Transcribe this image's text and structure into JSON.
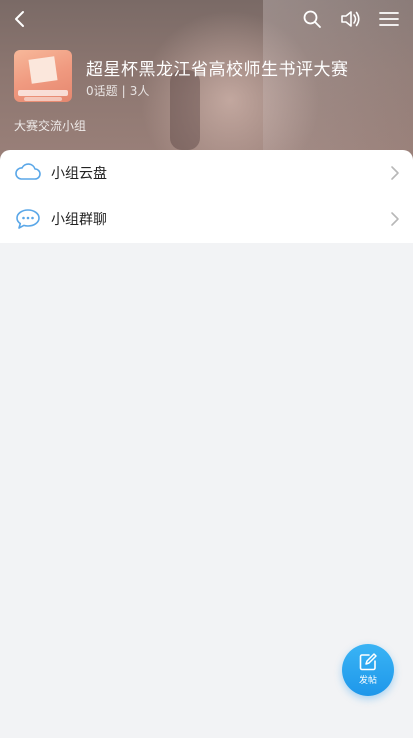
{
  "header": {
    "title": "超星杯黑龙江省高校师生书评大赛",
    "topics": "0话题",
    "separator": "|",
    "members": "3人",
    "description": "大赛交流小组",
    "logo_icon": "group-cover-image"
  },
  "toolbar": {
    "back_icon": "back-chevron-icon",
    "search_icon": "search-icon",
    "speaker_icon": "speaker-icon",
    "menu_icon": "menu-icon"
  },
  "entries": [
    {
      "label": "小组云盘",
      "icon": "cloud-icon"
    },
    {
      "label": "小组群聊",
      "icon": "chat-bubble-icon"
    }
  ],
  "fab": {
    "label": "发帖",
    "icon": "edit-icon"
  },
  "colors": {
    "accent": "#1e97ea",
    "icon_blue": "#5aa7e8",
    "background": "#f2f3f5"
  }
}
